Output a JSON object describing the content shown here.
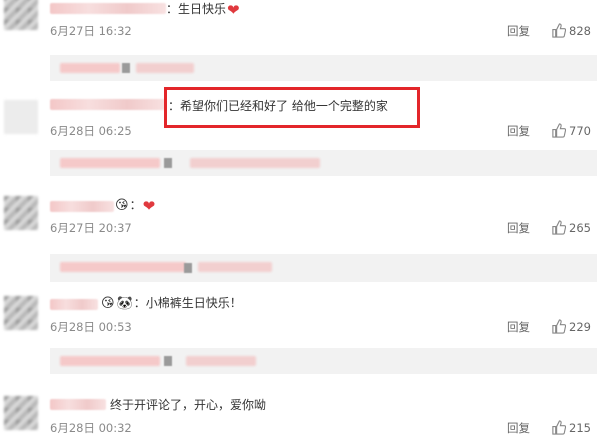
{
  "comments": [
    {
      "text_after": "生日快乐",
      "heart": true,
      "time": "6月27日 16:32",
      "reply": "回复",
      "likes": "828"
    },
    {
      "text_after": "希望你们已经和好了 给他一个完整的家",
      "heart": false,
      "time": "6月28日 06:25",
      "reply": "回复",
      "likes": "770"
    },
    {
      "text_after": "",
      "heart": true,
      "time": "6月27日 20:37",
      "reply": "回复",
      "likes": "265"
    },
    {
      "text_after": "小棉裤生日快乐！",
      "heart": false,
      "time": "6月28日 00:53",
      "reply": "回复",
      "likes": "229"
    },
    {
      "text_after": "终于开评论了，开心，爱你呦",
      "heart": false,
      "time": "6月28日 00:32",
      "reply": "回复",
      "likes": "215"
    }
  ],
  "icons": {
    "like": "thumbs-up-icon",
    "heart": "heart-icon",
    "highlight": "red-highlight-box"
  },
  "colors": {
    "highlight": "#e3262a",
    "heart": "#e0393e"
  }
}
